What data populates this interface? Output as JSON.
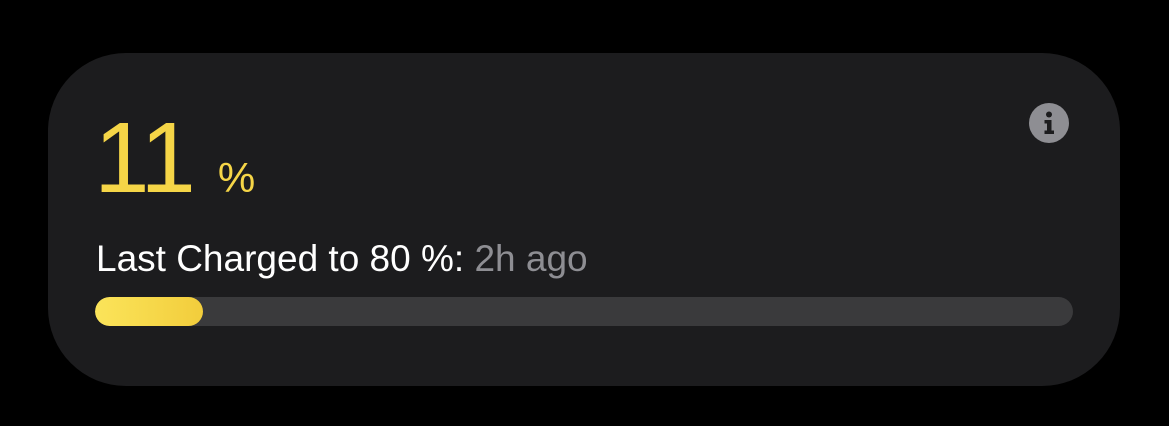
{
  "battery": {
    "level_value": "11",
    "level_unit": "%",
    "level_fraction": 0.11
  },
  "status": {
    "label": "Last Charged to 80 %:",
    "time": "2h ago"
  },
  "icons": {
    "info": "info-icon"
  },
  "colors": {
    "accent": "#f5d547",
    "card_background": "#1c1c1e",
    "track": "#3a3a3c",
    "secondary_text": "#8e8e93",
    "icon": "#8e8e93"
  }
}
